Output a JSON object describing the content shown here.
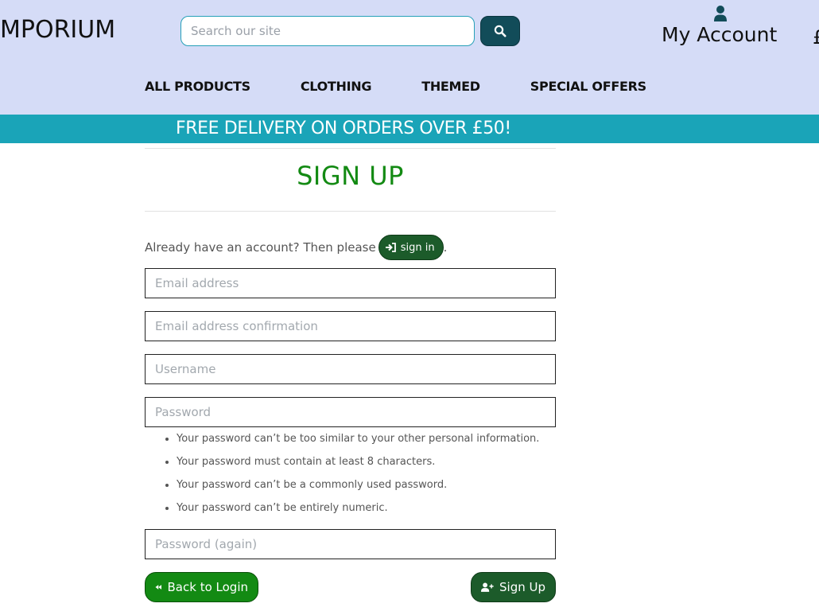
{
  "header": {
    "brand": "MPORIUM",
    "search_placeholder": "Search our site",
    "account_label": "My Account",
    "bag_text": "£"
  },
  "nav": {
    "items": [
      "ALL PRODUCTS",
      "CLOTHING",
      "THEMED",
      "SPECIAL OFFERS"
    ]
  },
  "banner": {
    "text": "FREE DELIVERY ON ORDERS OVER £50!"
  },
  "form": {
    "title": "SIGN UP",
    "already_text": "Already have an account? Then please",
    "signin_label": "sign in",
    "period": ".",
    "fields": {
      "email": "Email address",
      "email_confirm": "Email address confirmation",
      "username": "Username",
      "password": "Password",
      "password_again": "Password (again)"
    },
    "password_rules": [
      "Your password can’t be too similar to your other personal information.",
      "Your password must contain at least 8 characters.",
      "Your password can’t be a commonly used password.",
      "Your password can’t be entirely numeric."
    ],
    "back_label": "Back to Login",
    "signup_label": "Sign Up"
  },
  "colors": {
    "header_bg": "#d5dcf7",
    "banner_bg": "#1aa4b8",
    "title_green": "#138a13",
    "dark_green": "#1c5b2a",
    "search_button": "#124c59"
  },
  "icons": {
    "search": "search-icon",
    "account": "user-icon",
    "signin": "sign-in-icon",
    "back": "backward-icon",
    "signup": "user-plus-icon"
  }
}
